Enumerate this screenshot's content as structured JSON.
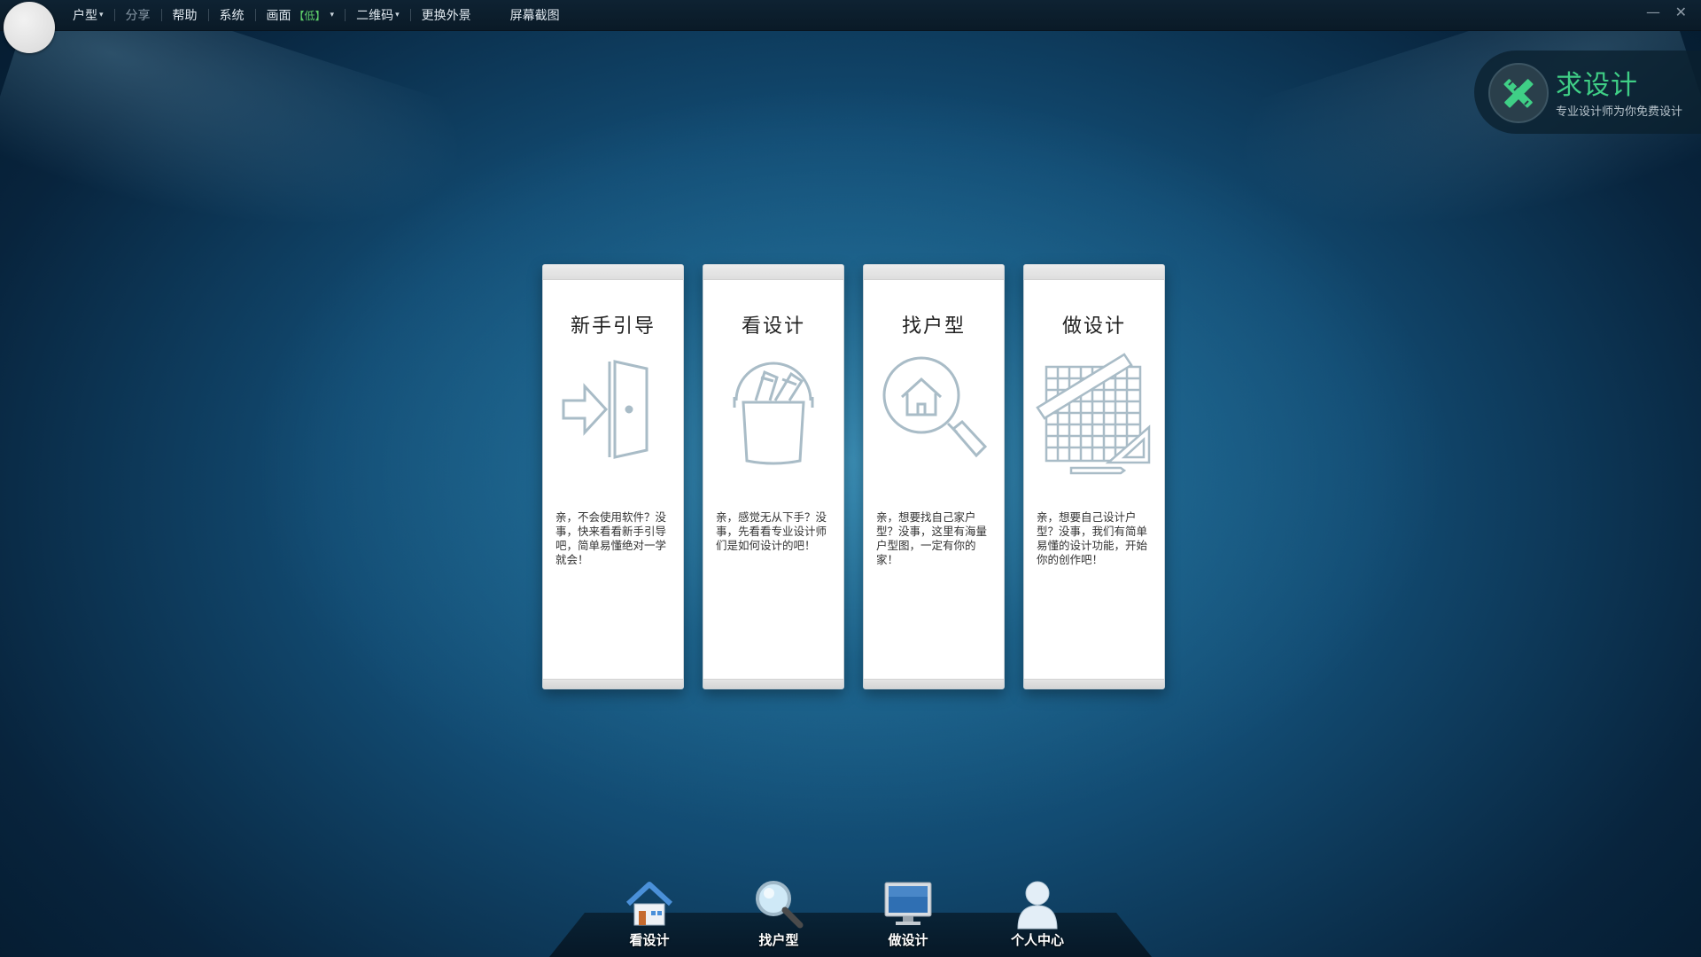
{
  "menu": {
    "items": [
      {
        "label": "户型",
        "caret": "▾"
      },
      {
        "label": "分享"
      },
      {
        "label": "帮助"
      },
      {
        "label": "系统"
      },
      {
        "label": "画面",
        "badge": "【低】",
        "caret": "▾"
      },
      {
        "label": "二维码",
        "caret": "▾"
      },
      {
        "label": "更换外景"
      },
      {
        "label": "屏幕截图"
      }
    ],
    "minimize": "—",
    "close": "✕"
  },
  "promo": {
    "title": "求设计",
    "subtitle": "专业设计师为你免费设计",
    "accent_color": "#3fcf86"
  },
  "cards": [
    {
      "title": "新手引导",
      "icon": "door-enter-icon",
      "desc": "亲，不会使用软件？没事，快来看看新手引导吧，简单易懂绝对一学就会！"
    },
    {
      "title": "看设计",
      "icon": "paint-bucket-icon",
      "desc": "亲，感觉无从下手？没事，先看看专业设计师们是如何设计的吧！"
    },
    {
      "title": "找户型",
      "icon": "house-search-icon",
      "desc": "亲，想要找自己家户型？没事，这里有海量户型图，一定有你的家！"
    },
    {
      "title": "做设计",
      "icon": "grid-ruler-icon",
      "desc": "亲，想要自己设计户型？没事，我们有简单易懂的设计功能，开始你的创作吧！"
    }
  ],
  "dock": [
    {
      "label": "看设计",
      "icon": "home-icon"
    },
    {
      "label": "找户型",
      "icon": "magnifier-icon"
    },
    {
      "label": "做设计",
      "icon": "monitor-icon"
    },
    {
      "label": "个人中心",
      "icon": "user-icon"
    }
  ]
}
